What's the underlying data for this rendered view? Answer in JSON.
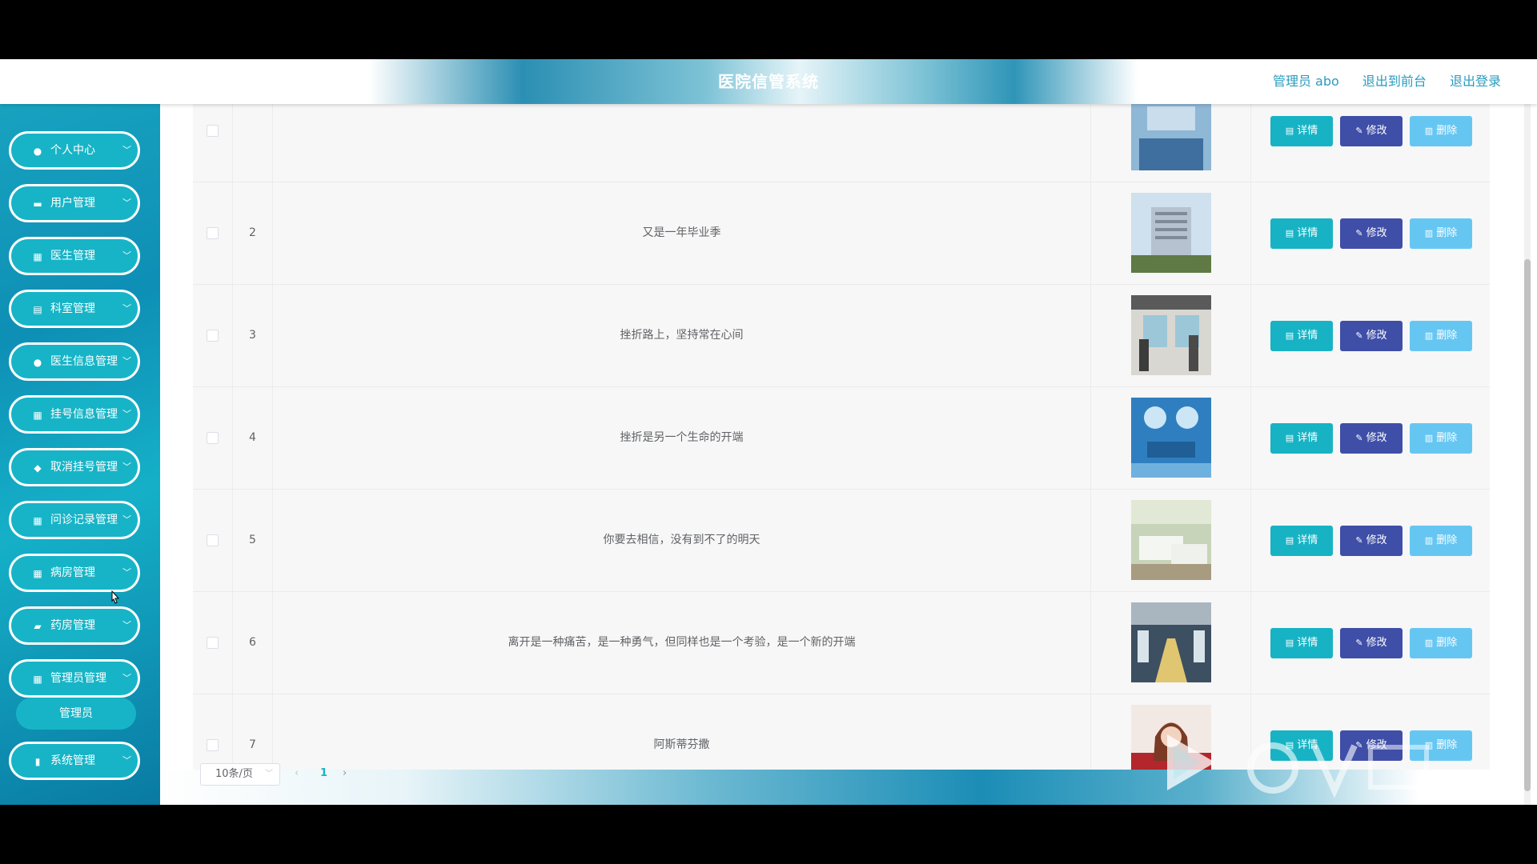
{
  "header": {
    "title": "医院信管系统",
    "user": "管理员 abo",
    "front": "退出到前台",
    "logout": "退出登录"
  },
  "sidebar": {
    "items": [
      {
        "label": "个人中心",
        "icon": "user-icon"
      },
      {
        "label": "用户管理",
        "icon": "briefcase-icon"
      },
      {
        "label": "医生管理",
        "icon": "grid-icon"
      },
      {
        "label": "科室管理",
        "icon": "clipboard-icon"
      },
      {
        "label": "医生信息管理",
        "icon": "user-icon"
      },
      {
        "label": "挂号信息管理",
        "icon": "grid-icon"
      },
      {
        "label": "取消挂号管理",
        "icon": "thumb-icon"
      },
      {
        "label": "问诊记录管理",
        "icon": "grid-icon"
      },
      {
        "label": "病房管理",
        "icon": "grid-icon"
      },
      {
        "label": "药房管理",
        "icon": "ticket-icon"
      },
      {
        "label": "管理员管理",
        "icon": "grid-icon"
      },
      {
        "label": "系统管理",
        "icon": "book-icon"
      }
    ],
    "sub_item": "管理员"
  },
  "table": {
    "rows": [
      {
        "index": "",
        "title": ""
      },
      {
        "index": "2",
        "title": "又是一年毕业季"
      },
      {
        "index": "3",
        "title": "挫折路上，坚持常在心间"
      },
      {
        "index": "4",
        "title": "挫折是另一个生命的开端"
      },
      {
        "index": "5",
        "title": "你要去相信，没有到不了的明天"
      },
      {
        "index": "6",
        "title": "离开是一种痛苦，是一种勇气，但同样也是一个考验，是一个新的开端"
      },
      {
        "index": "7",
        "title": "阿斯蒂芬撒"
      }
    ],
    "actions": {
      "detail": "详情",
      "edit": "修改",
      "delete": "删除"
    }
  },
  "pagination": {
    "page_size": "10条/页",
    "current_page": "1"
  },
  "colors": {
    "accent": "#17b3c5",
    "edit": "#3f4fa8",
    "delete": "#66c6f2"
  }
}
